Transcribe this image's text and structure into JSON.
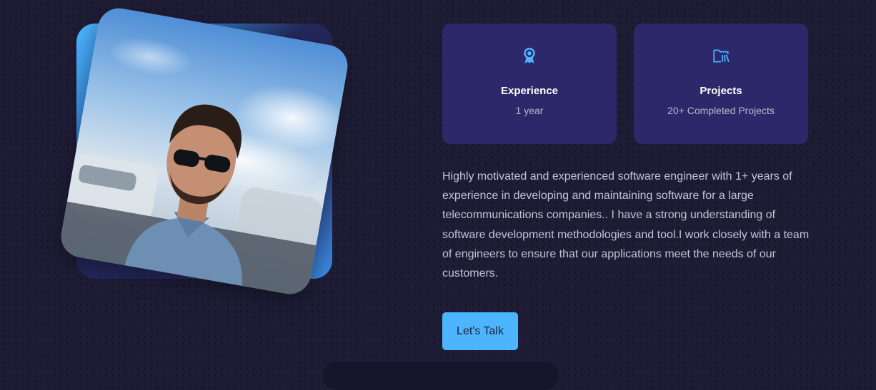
{
  "about": {
    "cards": [
      {
        "icon": "award-icon",
        "title": "Experience",
        "value": "1 year"
      },
      {
        "icon": "folder-library-icon",
        "title": "Projects",
        "value": "20+ Completed Projects"
      }
    ],
    "description": "Highly motivated and experienced software engineer with 1+ years of experience in developing and maintaining software for a large telecommunications companies.. I have a strong understanding of software development methodologies and tool.I work closely with a team of engineers to ensure that our applications meet the needs of our customers.",
    "cta_label": "Let's Talk"
  },
  "colors": {
    "background": "#1f1d36",
    "card": "#2c2869",
    "accent": "#4db5ff",
    "text_muted": "#c4c3d6"
  }
}
